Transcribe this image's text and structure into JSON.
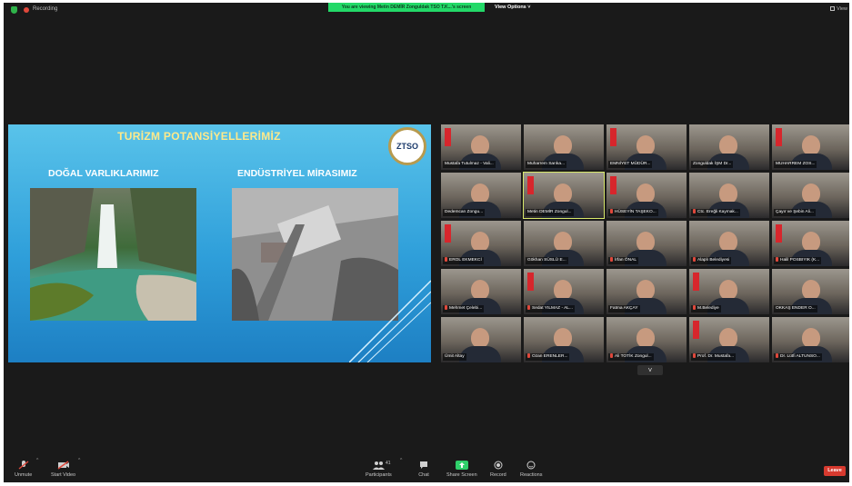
{
  "top_bar": {
    "recording_label": "Recording",
    "viewing_banner": "You are viewing Metin DEMİR Zonguldak TSO T.K...'s screen",
    "view_options_label": "View Options ˅",
    "view_label": "View"
  },
  "slide": {
    "title": "TURİZM POTANSİYELLERİMİZ",
    "logo_text": "ZTSO",
    "left_heading": "DOĞAL VARLIKLARIMIZ",
    "right_heading": "ENDÜSTRİYEL MİRASIMIZ"
  },
  "gallery": {
    "tiles": [
      {
        "name": "Mustafa Tutulmaz - Vali..."
      },
      {
        "name": "Muharrem Sarıka..."
      },
      {
        "name": "EMNİYET MÜDÜR..."
      },
      {
        "name": "Zonguldak İŞM Dr..."
      },
      {
        "name": "MUHARREM ZOS..."
      },
      {
        "name": "Dedemcan Zongu..."
      },
      {
        "name": "Metin DEMİR Zongul..."
      },
      {
        "name": "HÜSEYİN TAŞEKO..."
      },
      {
        "name": "Ctc. Ereğli Kaymak..."
      },
      {
        "name": "Çayır ve Şebin Ali..."
      },
      {
        "name": "EROL EKMEKCİ"
      },
      {
        "name": "Gökhan SÜSLÜ E..."
      },
      {
        "name": "İrfan ÖNAL"
      },
      {
        "name": "Alaplı Belediyesi"
      },
      {
        "name": "Halil POSBIYIK (K..."
      },
      {
        "name": "Mehmet Çelebi..."
      },
      {
        "name": "Sedat YILMAZ - AL..."
      },
      {
        "name": "Fatma AKÇAY"
      },
      {
        "name": "M.Belediye"
      },
      {
        "name": "OKKAŞ ENDER O..."
      },
      {
        "name": "Ümit Altay"
      },
      {
        "name": "Ozan ERENLER..."
      },
      {
        "name": "Ali TOTİK Zongul..."
      },
      {
        "name": "Prof. Dr. Mustafa..."
      },
      {
        "name": "Dr. Lütfi ALTUNSO..."
      }
    ],
    "next_page_label": "˅"
  },
  "toolbar": {
    "unmute_label": "Unmute",
    "start_video_label": "Start Video",
    "participants_label": "Participants",
    "participants_count": "41",
    "chat_label": "Chat",
    "share_screen_label": "Share Screen",
    "record_label": "Record",
    "reactions_label": "Reactions",
    "leave_label": "Leave"
  },
  "colors": {
    "meeting_bg": "#1a1a1a",
    "banner_green": "#23d968",
    "leave_red": "#d73a2f",
    "slide_blue": "#2f9fda"
  }
}
